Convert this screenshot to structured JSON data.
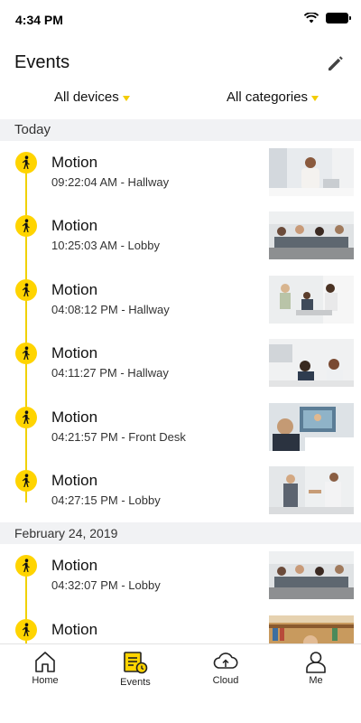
{
  "status": {
    "time": "4:34 PM",
    "icons": [
      "wifi-icon",
      "battery-icon"
    ]
  },
  "header": {
    "title": "Events",
    "edit_icon": "pencil-icon"
  },
  "filters": {
    "devices": "All devices",
    "categories": "All categories",
    "caret_color": "#f3cc00"
  },
  "sections": [
    {
      "label": "Today",
      "events": [
        {
          "title": "Motion",
          "subtitle": "09:22:04 AM - Hallway"
        },
        {
          "title": "Motion",
          "subtitle": "10:25:03 AM - Lobby"
        },
        {
          "title": "Motion",
          "subtitle": "04:08:12 PM - Hallway"
        },
        {
          "title": "Motion",
          "subtitle": "04:11:27 PM - Hallway"
        },
        {
          "title": "Motion",
          "subtitle": "04:21:57 PM - Front Desk"
        },
        {
          "title": "Motion",
          "subtitle": "04:27:15 PM - Lobby"
        }
      ]
    },
    {
      "label": "February 24, 2019",
      "events": [
        {
          "title": "Motion",
          "subtitle": "04:32:07 PM - Lobby"
        },
        {
          "title": "Motion",
          "subtitle": ""
        }
      ]
    }
  ],
  "tabs": [
    {
      "label": "Home",
      "icon": "home-icon",
      "active": false
    },
    {
      "label": "Events",
      "icon": "events-icon",
      "active": true
    },
    {
      "label": "Cloud",
      "icon": "cloud-icon",
      "active": false
    },
    {
      "label": "Me",
      "icon": "person-icon",
      "active": false
    }
  ],
  "colors": {
    "accent": "#ffd400",
    "timeline": "#f0d100",
    "section_bg": "#f1f2f4"
  }
}
